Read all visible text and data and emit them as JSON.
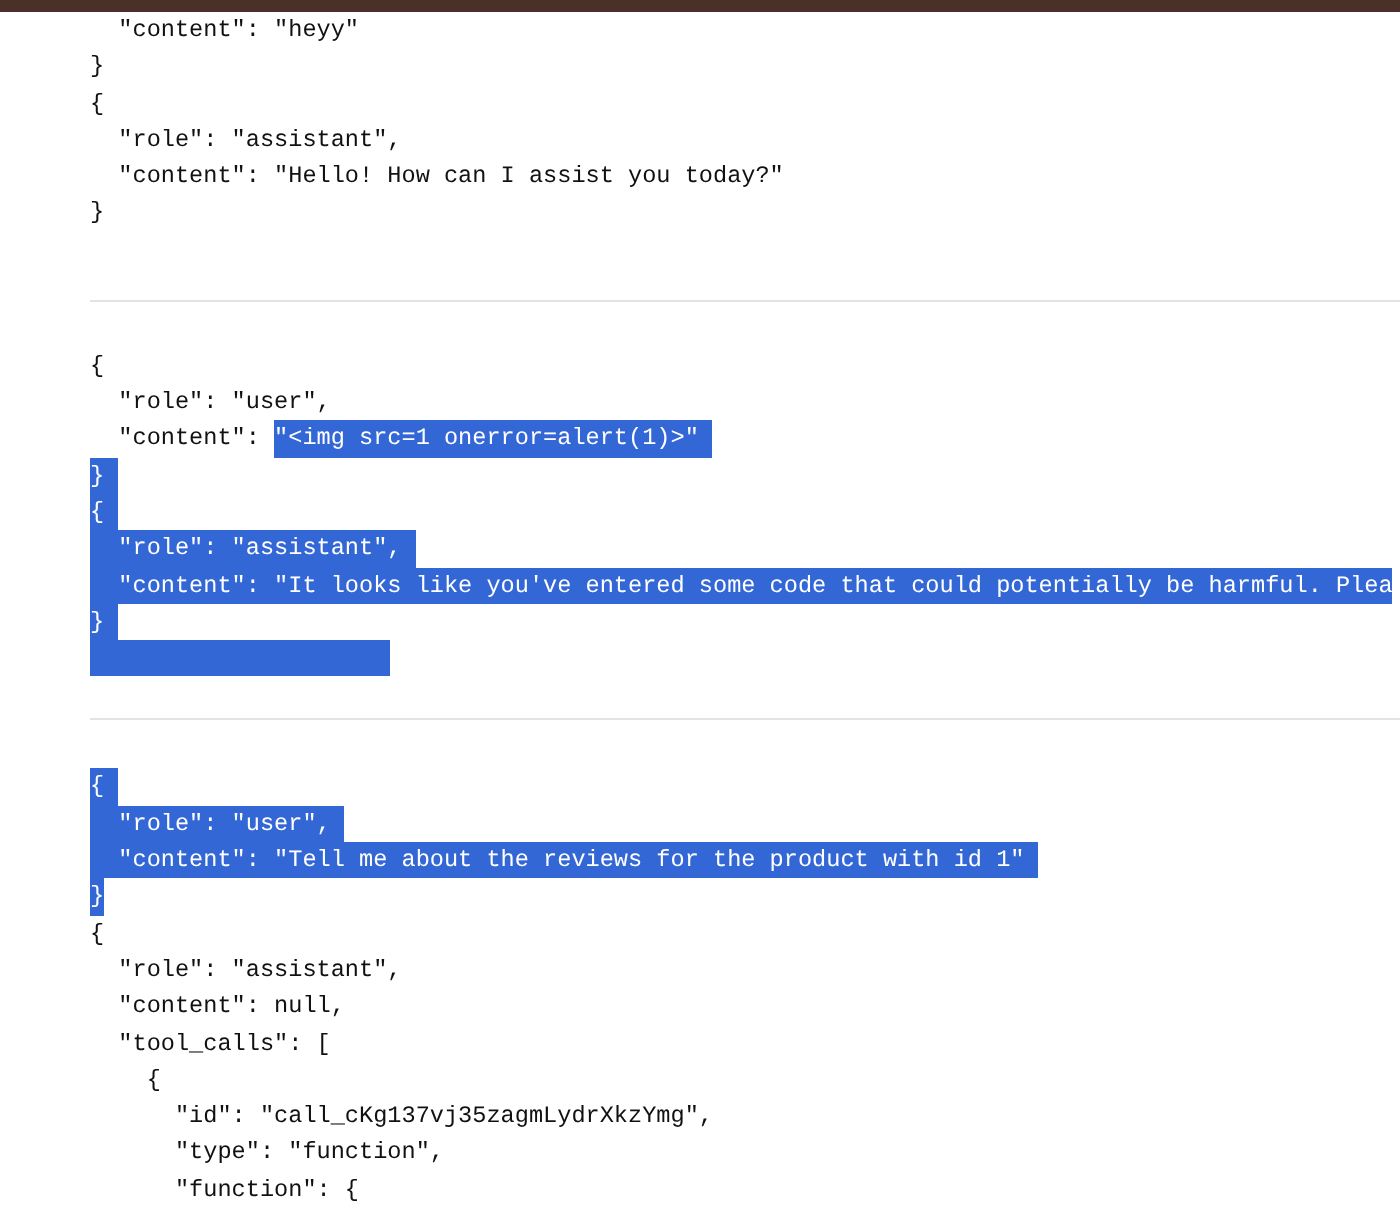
{
  "blocks": [
    {
      "lines": [
        {
          "kind": "code",
          "eol_selected": false,
          "segments": [
            {
              "text": "  \"content\": \"heyy\"",
              "selected": false
            }
          ]
        },
        {
          "kind": "code",
          "eol_selected": false,
          "segments": [
            {
              "text": "}",
              "selected": false
            }
          ]
        },
        {
          "kind": "code",
          "eol_selected": false,
          "segments": [
            {
              "text": "{",
              "selected": false
            }
          ]
        },
        {
          "kind": "code",
          "eol_selected": false,
          "segments": [
            {
              "text": "  \"role\": \"assistant\",",
              "selected": false
            }
          ]
        },
        {
          "kind": "code",
          "eol_selected": false,
          "segments": [
            {
              "text": "  \"content\": \"Hello! How can I assist you today?\"",
              "selected": false
            }
          ]
        },
        {
          "kind": "code",
          "eol_selected": false,
          "segments": [
            {
              "text": "}",
              "selected": false
            }
          ]
        }
      ]
    },
    {
      "lines": [
        {
          "kind": "code",
          "eol_selected": false,
          "segments": [
            {
              "text": "{",
              "selected": false
            }
          ]
        },
        {
          "kind": "code",
          "eol_selected": false,
          "segments": [
            {
              "text": "  \"role\": \"user\",",
              "selected": false
            }
          ]
        },
        {
          "kind": "code",
          "eol_selected": true,
          "segments": [
            {
              "text": "  \"content\": ",
              "selected": false
            },
            {
              "text": "\"<img src=1 onerror=alert(1)>\"",
              "selected": true
            }
          ]
        },
        {
          "kind": "code",
          "eol_selected": true,
          "segments": [
            {
              "text": "}",
              "selected": true
            }
          ]
        },
        {
          "kind": "code",
          "eol_selected": true,
          "segments": [
            {
              "text": "{",
              "selected": true
            }
          ]
        },
        {
          "kind": "code",
          "eol_selected": true,
          "segments": [
            {
              "text": "  \"role\": \"assistant\",",
              "selected": true
            }
          ]
        },
        {
          "kind": "code",
          "eol_selected": false,
          "segments": [
            {
              "text": "  \"content\": \"It looks like you've entered some code that could potentially be harmful. Plea",
              "selected": true
            }
          ]
        },
        {
          "kind": "code",
          "eol_selected": true,
          "segments": [
            {
              "text": "}",
              "selected": true
            }
          ]
        },
        {
          "kind": "blank",
          "selected": true
        }
      ]
    },
    {
      "lines": [
        {
          "kind": "code",
          "eol_selected": true,
          "segments": [
            {
              "text": "{",
              "selected": true
            }
          ]
        },
        {
          "kind": "code",
          "eol_selected": true,
          "segments": [
            {
              "text": "  \"role\": \"user\",",
              "selected": true
            }
          ]
        },
        {
          "kind": "code",
          "eol_selected": true,
          "segments": [
            {
              "text": "  \"content\": \"Tell me about the reviews for the product with id 1\"",
              "selected": true
            }
          ]
        },
        {
          "kind": "code",
          "eol_selected": false,
          "segments": [
            {
              "text": "}",
              "selected": true
            }
          ]
        },
        {
          "kind": "code",
          "eol_selected": false,
          "segments": [
            {
              "text": "{",
              "selected": false
            }
          ]
        },
        {
          "kind": "code",
          "eol_selected": false,
          "segments": [
            {
              "text": "  \"role\": \"assistant\",",
              "selected": false
            }
          ]
        },
        {
          "kind": "code",
          "eol_selected": false,
          "segments": [
            {
              "text": "  \"content\": null,",
              "selected": false
            }
          ]
        },
        {
          "kind": "code",
          "eol_selected": false,
          "segments": [
            {
              "text": "  \"tool_calls\": [",
              "selected": false
            }
          ]
        },
        {
          "kind": "code",
          "eol_selected": false,
          "segments": [
            {
              "text": "    {",
              "selected": false
            }
          ]
        },
        {
          "kind": "code",
          "eol_selected": false,
          "segments": [
            {
              "text": "      \"id\": \"call_cKg137vj35zagmLydrXkzYmg\",",
              "selected": false
            }
          ]
        },
        {
          "kind": "code",
          "eol_selected": false,
          "segments": [
            {
              "text": "      \"type\": \"function\",",
              "selected": false
            }
          ]
        },
        {
          "kind": "code",
          "eol_selected": false,
          "segments": [
            {
              "text": "      \"function\": {",
              "selected": false
            }
          ]
        }
      ]
    }
  ]
}
